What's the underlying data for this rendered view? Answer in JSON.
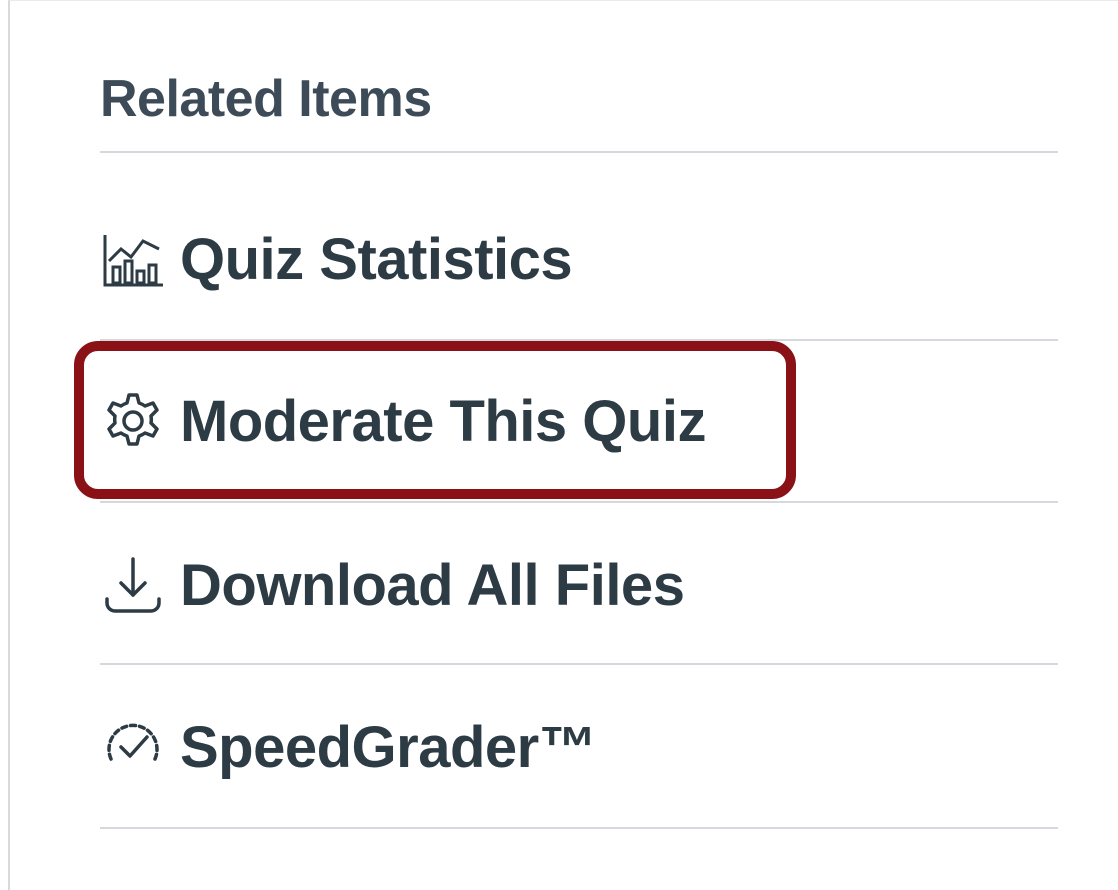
{
  "sidebar": {
    "heading": "Related Items",
    "items": [
      {
        "label": "Quiz Statistics",
        "icon": "stats-chart-icon"
      },
      {
        "label": "Moderate This Quiz",
        "icon": "gear-icon"
      },
      {
        "label": "Download All Files",
        "icon": "download-icon"
      },
      {
        "label": "SpeedGrader™",
        "icon": "speedgrader-icon"
      }
    ]
  },
  "colors": {
    "text": "#2d3b45",
    "heading": "#3c4b57",
    "divider": "#d5d9dd",
    "highlight": "#8a1216"
  }
}
